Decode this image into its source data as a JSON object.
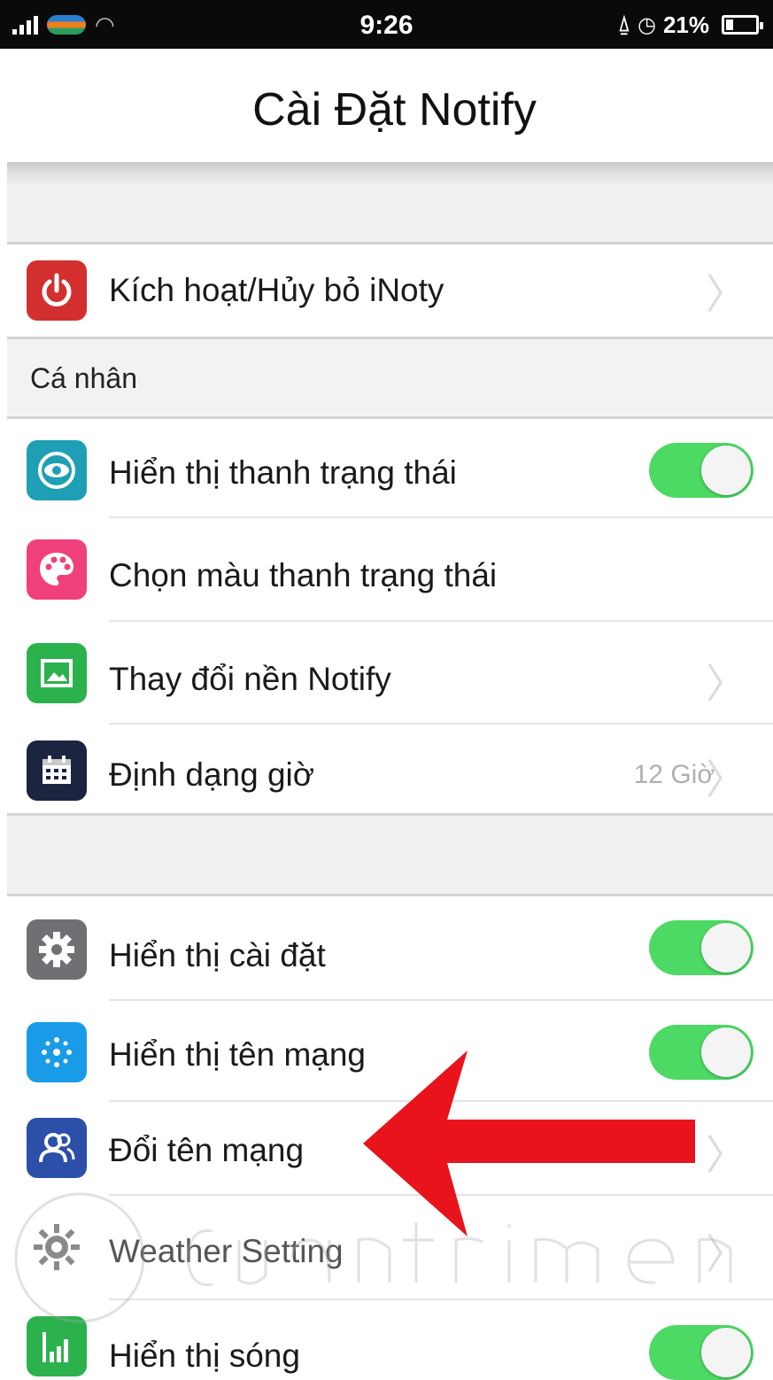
{
  "status_bar": {
    "time": "9:26",
    "battery_text": "21%",
    "icons": [
      "signal-icon",
      "carrier-logo",
      "wifi-icon",
      "alarm-icon",
      "clock-icon",
      "battery-icon"
    ]
  },
  "navbar": {
    "title": "Cài Đặt Notify"
  },
  "sections": {
    "personal_header": "Cá nhân"
  },
  "rows": {
    "activate": {
      "label": "Kích hoạt/Hủy bỏ iNoty",
      "icon": "power-icon",
      "icon_color": "#d32f2f"
    },
    "show_statusbar": {
      "label": "Hiển thị thanh trạng thái",
      "icon": "eye-icon",
      "icon_color": "#1e9fb5",
      "toggle": true
    },
    "statusbar_color": {
      "label": "Chọn màu thanh trạng thái",
      "icon": "palette-icon",
      "icon_color": "#f0407a"
    },
    "change_background": {
      "label": "Thay đổi nền Notify",
      "icon": "image-icon",
      "icon_color": "#2bb24c"
    },
    "time_format": {
      "label": "Định dạng giờ",
      "value": "12 Giờ",
      "icon": "calendar-icon",
      "icon_color": "#1c2540"
    },
    "show_settings": {
      "label": "Hiển thị cài đặt",
      "icon": "gear-icon",
      "icon_color": "#6f6f74",
      "toggle": true
    },
    "show_network_name": {
      "label": "Hiển thị tên mạng",
      "icon": "network-icon",
      "icon_color": "#1a9be8",
      "toggle": true
    },
    "rename_network": {
      "label": "Đổi tên mạng",
      "icon": "users-icon",
      "icon_color": "#2c4fa8"
    },
    "weather_setting": {
      "label": "Weather Setting",
      "icon": "weather-icon",
      "icon_color": "#9a9a9a"
    },
    "show_signal": {
      "label": "Hiển thị sóng",
      "icon": "signal-bars-icon",
      "icon_color": "#2bb24c",
      "toggle": true
    }
  },
  "colors": {
    "toggle_on": "#4cd964",
    "arrow": "#e8131b",
    "group_background": "#f0f0f0"
  }
}
